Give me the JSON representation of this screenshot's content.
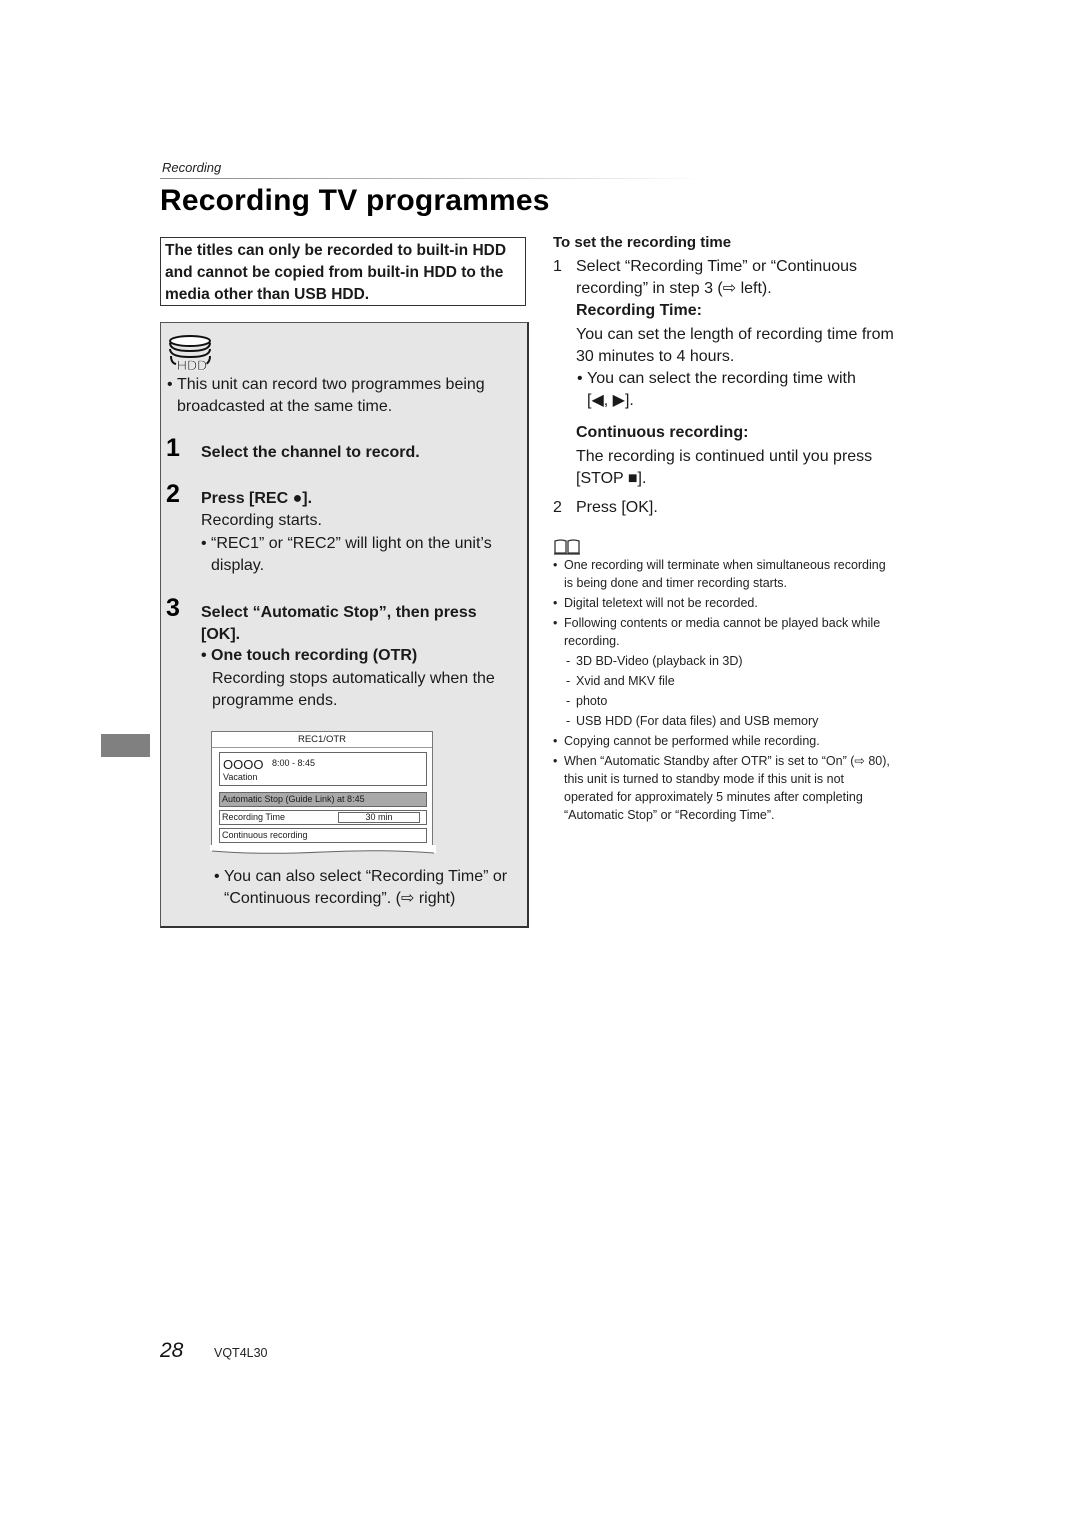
{
  "header": {
    "section": "Recording",
    "title": "Recording TV programmes"
  },
  "notice": "The titles can only be recorded to built-in HDD and cannot be copied from built-in HDD to the media other than USB HDD.",
  "procedure": {
    "media_icon_label": "HDD",
    "intro_bullet_line1": "This unit can record two programmes being",
    "intro_bullet_line2": "broadcasted at the same time.",
    "steps": [
      {
        "number": "1",
        "title": "Select the channel to record."
      },
      {
        "number": "2",
        "title": "Press [REC ●].",
        "detail": "Recording starts.",
        "bullet_line1": "“REC1” or “REC2” will light on the unit’s",
        "bullet_line2": "display."
      },
      {
        "number": "3",
        "title_line1": "Select “Automatic Stop”, then press",
        "title_line2": "[OK].",
        "sub_bullet": "One touch recording (OTR)",
        "sub_line1": "Recording stops automatically when the",
        "sub_line2": "programme ends.",
        "bullet_line1": "You can also select “Recording Time” or",
        "bullet_line2": "“Continuous recording”. (⇨ right)"
      }
    ],
    "osd": {
      "title": "REC1/OTR",
      "channel": "OOOO",
      "time": "8:00 - 8:45",
      "programme": "Vacation",
      "options": [
        {
          "label": "Automatic Stop (Guide Link) at 8:45",
          "selected": true
        },
        {
          "label": "Recording Time",
          "value": "30 min",
          "selected": false
        },
        {
          "label": "Continuous recording",
          "selected": false
        }
      ]
    }
  },
  "right": {
    "heading": "To set the recording time",
    "step1_num": "1",
    "step1_line1": "Select “Recording Time” or “Continuous",
    "step1_line2": "recording” in step 3 (⇨ left).",
    "rt_heading": "Recording Time:",
    "rt_line1": "You can set the length of recording time from",
    "rt_line2": "30 minutes to 4 hours.",
    "rt_bullet_line1": "You can select the recording time with",
    "rt_bullet_line2": "[◀, ▶].",
    "cr_heading": "Continuous recording:",
    "cr_line1": "The recording is continued until you press",
    "cr_line2": "[STOP ■].",
    "step2_num": "2",
    "step2": "Press [OK]."
  },
  "notes": {
    "icon": "book-icon",
    "items": [
      {
        "type": "bullet",
        "lines": [
          "One recording will terminate when simultaneous recording",
          "is being done and timer recording starts."
        ]
      },
      {
        "type": "bullet",
        "lines": [
          "Digital teletext will not be recorded."
        ]
      },
      {
        "type": "bullet",
        "lines": [
          "Following contents or media cannot be played back while",
          "recording."
        ]
      },
      {
        "type": "dash",
        "lines": [
          "3D BD-Video (playback in 3D)"
        ]
      },
      {
        "type": "dash",
        "lines": [
          "Xvid and MKV file"
        ]
      },
      {
        "type": "dash",
        "lines": [
          "photo"
        ]
      },
      {
        "type": "dash",
        "lines": [
          "USB HDD (For data files) and USB memory"
        ]
      },
      {
        "type": "bullet",
        "lines": [
          "Copying cannot be performed while recording."
        ]
      },
      {
        "type": "bullet",
        "lines": [
          "When “Automatic Standby after OTR” is set to “On” (⇨ 80),",
          "this unit is turned to standby mode if this unit is not",
          "operated for approximately 5 minutes after completing",
          "“Automatic Stop” or “Recording Time”."
        ]
      }
    ]
  },
  "footer": {
    "page_number": "28",
    "doc_code": "VQT4L30"
  }
}
